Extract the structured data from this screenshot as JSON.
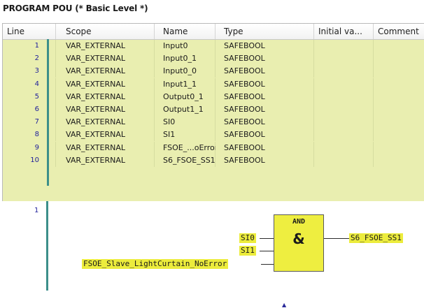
{
  "title": "PROGRAM POU (* Basic Level *)",
  "columns": [
    "Line",
    "Scope",
    "Name",
    "Type",
    "Initial va...",
    "Comment"
  ],
  "rows": [
    {
      "line": "1",
      "scope": "VAR_EXTERNAL",
      "name": "Input0",
      "type": "SAFEBOOL"
    },
    {
      "line": "2",
      "scope": "VAR_EXTERNAL",
      "name": "Input0_1",
      "type": "SAFEBOOL"
    },
    {
      "line": "3",
      "scope": "VAR_EXTERNAL",
      "name": "Input0_0",
      "type": "SAFEBOOL"
    },
    {
      "line": "4",
      "scope": "VAR_EXTERNAL",
      "name": "Input1_1",
      "type": "SAFEBOOL"
    },
    {
      "line": "5",
      "scope": "VAR_EXTERNAL",
      "name": "Output0_1",
      "type": "SAFEBOOL"
    },
    {
      "line": "6",
      "scope": "VAR_EXTERNAL",
      "name": "Output1_1",
      "type": "SAFEBOOL"
    },
    {
      "line": "7",
      "scope": "VAR_EXTERNAL",
      "name": "SI0",
      "type": "SAFEBOOL"
    },
    {
      "line": "8",
      "scope": "VAR_EXTERNAL",
      "name": "SI1",
      "type": "SAFEBOOL"
    },
    {
      "line": "9",
      "scope": "VAR_EXTERNAL",
      "name": "FSOE_...oError",
      "type": "SAFEBOOL"
    },
    {
      "line": "10",
      "scope": "VAR_EXTERNAL",
      "name": "S6_FSOE_SS1",
      "type": "SAFEBOOL"
    }
  ],
  "editor": {
    "line_number": "1",
    "block_type": "AND",
    "block_symbol": "&",
    "inputs": [
      "SI0",
      "SI1",
      "FSOE_Slave_LightCurtain_NoError"
    ],
    "output": "S6_FSOE_SS1"
  },
  "colors": {
    "table_background": "#e9eeb0",
    "line_bar": "#3c8f8a",
    "variable_highlight": "#ecec3c",
    "block_fill": "#eeee40"
  }
}
